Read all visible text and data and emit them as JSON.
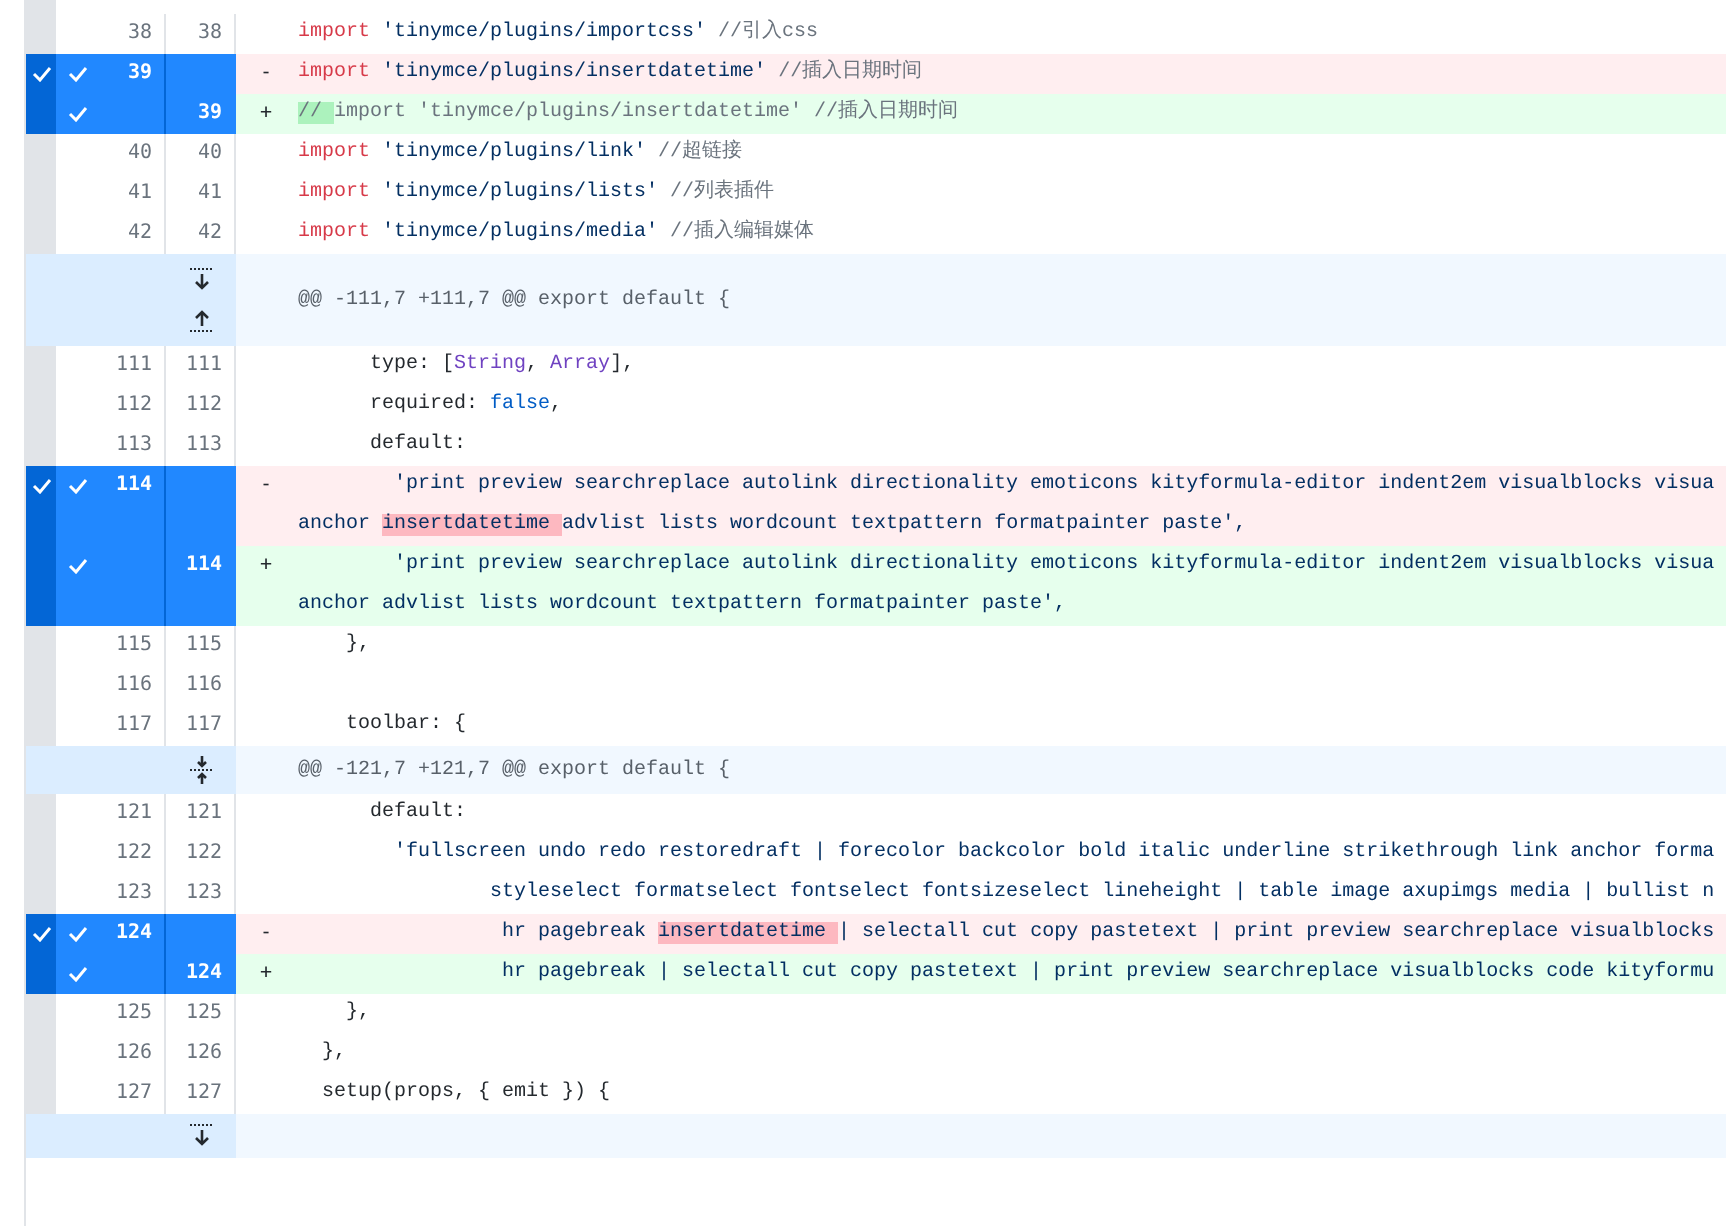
{
  "diff": {
    "rows": [
      {
        "kind": "context",
        "old": "38",
        "new": "38",
        "selected": false,
        "code": [
          [
            {
              "text": "import ",
              "kind": "keyword"
            },
            {
              "text": "'tinymce/plugins/importcss' ",
              "kind": "string"
            },
            {
              "text": "//引入css",
              "kind": "comment"
            }
          ]
        ]
      },
      {
        "kind": "deleted",
        "old": "39",
        "selected": true,
        "block_checked": true,
        "sign": "-",
        "code": [
          [
            {
              "text": "import ",
              "kind": "keyword"
            },
            {
              "text": "'tinymce/plugins/insertdatetime' ",
              "kind": "string"
            },
            {
              "text": "//插入日期时间",
              "kind": "comment"
            }
          ]
        ]
      },
      {
        "kind": "added",
        "new": "39",
        "selected": true,
        "block_checked": false,
        "sign": "+",
        "code": [
          [
            {
              "text": "// ",
              "kind": "comment",
              "marked": true
            },
            {
              "text": "import 'tinymce/plugins/insertdatetime' //插入日期时间",
              "kind": "comment"
            }
          ]
        ]
      },
      {
        "kind": "context",
        "old": "40",
        "new": "40",
        "selected": false,
        "code": [
          [
            {
              "text": "import ",
              "kind": "keyword"
            },
            {
              "text": "'tinymce/plugins/link' ",
              "kind": "string"
            },
            {
              "text": "//超链接",
              "kind": "comment"
            }
          ]
        ]
      },
      {
        "kind": "context",
        "old": "41",
        "new": "41",
        "selected": false,
        "code": [
          [
            {
              "text": "import ",
              "kind": "keyword"
            },
            {
              "text": "'tinymce/plugins/lists' ",
              "kind": "string"
            },
            {
              "text": "//列表插件",
              "kind": "comment"
            }
          ]
        ]
      },
      {
        "kind": "context",
        "old": "42",
        "new": "42",
        "selected": false,
        "code": [
          [
            {
              "text": "import ",
              "kind": "keyword"
            },
            {
              "text": "'tinymce/plugins/media' ",
              "kind": "string"
            },
            {
              "text": "//插入编辑媒体",
              "kind": "comment"
            }
          ]
        ]
      },
      {
        "kind": "hunk",
        "expander": {
          "kind": "both"
        },
        "header": "@@ -111,7 +111,7 @@ export default {"
      },
      {
        "kind": "context",
        "old": "111",
        "new": "111",
        "selected": false,
        "code": [
          [
            {
              "text": "      type: [",
              "kind": "plain"
            },
            {
              "text": "String",
              "kind": "builtin"
            },
            {
              "text": ", ",
              "kind": "plain"
            },
            {
              "text": "Array",
              "kind": "builtin"
            },
            {
              "text": "],",
              "kind": "plain"
            }
          ]
        ]
      },
      {
        "kind": "context",
        "old": "112",
        "new": "112",
        "selected": false,
        "code": [
          [
            {
              "text": "      required: ",
              "kind": "plain"
            },
            {
              "text": "false",
              "kind": "literal"
            },
            {
              "text": ",",
              "kind": "plain"
            }
          ]
        ]
      },
      {
        "kind": "context",
        "old": "113",
        "new": "113",
        "selected": false,
        "code": [
          [
            {
              "text": "      default:",
              "kind": "plain"
            }
          ]
        ]
      },
      {
        "kind": "deleted",
        "old": "114",
        "selected": true,
        "block_checked": true,
        "sign": "-",
        "code": [
          [
            {
              "text": "        'print preview searchreplace autolink directionality emoticons kityformula-editor indent2em visualblocks visua",
              "kind": "string"
            }
          ],
          [
            {
              "text": "anchor ",
              "kind": "string"
            },
            {
              "text": "insertdatetime ",
              "kind": "string",
              "marked": true
            },
            {
              "text": "advlist lists wordcount textpattern formatpainter paste',",
              "kind": "string"
            }
          ]
        ]
      },
      {
        "kind": "added",
        "new": "114",
        "selected": true,
        "block_checked": false,
        "sign": "+",
        "code": [
          [
            {
              "text": "        'print preview searchreplace autolink directionality emoticons kityformula-editor indent2em visualblocks visua",
              "kind": "string"
            }
          ],
          [
            {
              "text": "anchor advlist lists wordcount textpattern formatpainter paste',",
              "kind": "string"
            }
          ]
        ]
      },
      {
        "kind": "context",
        "old": "115",
        "new": "115",
        "selected": false,
        "code": [
          [
            {
              "text": "    },",
              "kind": "plain"
            }
          ]
        ]
      },
      {
        "kind": "context",
        "old": "116",
        "new": "116",
        "selected": false,
        "code": []
      },
      {
        "kind": "context",
        "old": "117",
        "new": "117",
        "selected": false,
        "code": [
          [
            {
              "text": "    toolbar: {",
              "kind": "plain"
            }
          ]
        ]
      },
      {
        "kind": "hunk",
        "expander": {
          "kind": "join"
        },
        "header": "@@ -121,7 +121,7 @@ export default {"
      },
      {
        "kind": "context",
        "old": "121",
        "new": "121",
        "selected": false,
        "code": [
          [
            {
              "text": "      default:",
              "kind": "plain"
            }
          ]
        ]
      },
      {
        "kind": "context",
        "old": "122",
        "new": "122",
        "selected": false,
        "code": [
          [
            {
              "text": "        'fullscreen undo redo restoredraft | forecolor backcolor bold italic underline strikethrough link anchor forma",
              "kind": "string"
            }
          ]
        ]
      },
      {
        "kind": "context",
        "old": "123",
        "new": "123",
        "selected": false,
        "code": [
          [
            {
              "text": "                styleselect formatselect fontselect fontsizeselect lineheight | table image axupimgs media | bullist n",
              "kind": "string"
            }
          ]
        ]
      },
      {
        "kind": "deleted",
        "old": "124",
        "selected": true,
        "block_checked": true,
        "sign": "-",
        "code": [
          [
            {
              "text": "                 hr pagebreak ",
              "kind": "string"
            },
            {
              "text": "insertdatetime ",
              "kind": "string",
              "marked": true
            },
            {
              "text": "| selectall cut copy pastetext | print preview searchreplace visualblocks",
              "kind": "string"
            }
          ]
        ]
      },
      {
        "kind": "added",
        "new": "124",
        "selected": true,
        "block_checked": false,
        "sign": "+",
        "code": [
          [
            {
              "text": "                 hr pagebreak | selectall cut copy pastetext | print preview searchreplace visualblocks code kityformu",
              "kind": "string"
            }
          ]
        ]
      },
      {
        "kind": "context",
        "old": "125",
        "new": "125",
        "selected": false,
        "code": [
          [
            {
              "text": "    },",
              "kind": "plain"
            }
          ]
        ]
      },
      {
        "kind": "context",
        "old": "126",
        "new": "126",
        "selected": false,
        "code": [
          [
            {
              "text": "  },",
              "kind": "plain"
            }
          ]
        ]
      },
      {
        "kind": "context",
        "old": "127",
        "new": "127",
        "selected": false,
        "code": [
          [
            {
              "text": "  setup(props, { emit }) {",
              "kind": "plain"
            }
          ]
        ]
      },
      {
        "kind": "hunk",
        "expander": {
          "kind": "down"
        }
      }
    ]
  }
}
